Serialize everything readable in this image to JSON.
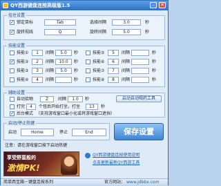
{
  "window": {
    "title": "QY西游键盘连按高级版1.5"
  },
  "titlebar": {
    "min_glyph": "–",
    "close_glyph": "✕"
  },
  "groups": {
    "hang": "挂住设置",
    "tech": "技能设置",
    "assist": "辅助设置",
    "startstop": "启动/停止热键"
  },
  "hang": {
    "lock_target": {
      "label": "锁定目标",
      "key": "Tab",
      "checked": true
    },
    "spin_target": {
      "label": "旋转视线",
      "key": "Q",
      "checked": true
    },
    "select_interval": {
      "label": "选择间隔",
      "value": "3.0",
      "unit": "秒"
    },
    "spin_interval": {
      "label": "旋转间隔",
      "value": "5.0",
      "unit": "秒"
    }
  },
  "skills": [
    {
      "label": "技能①",
      "key": "1",
      "interval_label": "间隔",
      "interval": "5.0",
      "unit": "秒",
      "checked": false,
      "right": {
        "label": "技能⑤",
        "key": "5",
        "interval_label": "间隔",
        "interval": "",
        "unit": "秒",
        "checked": false
      }
    },
    {
      "label": "技能②",
      "key": "2",
      "interval_label": "间隔",
      "interval": "10.0",
      "unit": "秒",
      "checked": true,
      "right": {
        "label": "技能⑥",
        "key": "6",
        "interval_label": "间隔",
        "interval": "",
        "unit": "秒",
        "checked": false
      }
    },
    {
      "label": "技能③",
      "key": "3",
      "interval_label": "间隔",
      "interval": "5.0",
      "unit": "秒",
      "checked": false,
      "right": {
        "label": "技能⑦",
        "key": "7",
        "interval_label": "间隔",
        "interval": "",
        "unit": "秒",
        "checked": false
      }
    },
    {
      "label": "技能④",
      "key": "4",
      "interval_label": "间隔",
      "interval": "",
      "unit": "秒",
      "checked": false,
      "right": {
        "label": "技能⑧",
        "key": "8",
        "interval_label": "间隔",
        "interval": "",
        "unit": "秒",
        "checked": false
      }
    }
  ],
  "assist": {
    "auto_pick": {
      "label": "自动拾物",
      "key": "Z",
      "interval_label": "间隔",
      "interval": "1.0",
      "unit": "秒",
      "checked": false
    },
    "tool_button": "启动自动喝药工具",
    "beat": {
      "label": "打完",
      "count": "4",
      "mid": "个怪后开始打坐，打坐",
      "time": "13",
      "unit": "秒",
      "checked": false
    },
    "background": {
      "label": "后台模式",
      "hint": "（支持游戏窗口最小化或将游戏窗口遮挡）",
      "checked": true
    }
  },
  "hotkeys": {
    "start_label": "启动",
    "start_value": "Home",
    "stop_label": "停止",
    "stop_value": "End"
  },
  "save_button": "保存设置",
  "notice": "注意：请在游戏窗口按下启动热键",
  "banner": {
    "title": "享受野蛮般的",
    "headline": "激情PK!"
  },
  "ad": {
    "line1": "QY西游键盘连按使用说明",
    "line2": "点击更新最新QY西游工具"
  },
  "status": {
    "left": "简单西宝箱－键盘连按系列",
    "right_label": "官方网站：",
    "url": "www.jdbbx.com"
  }
}
